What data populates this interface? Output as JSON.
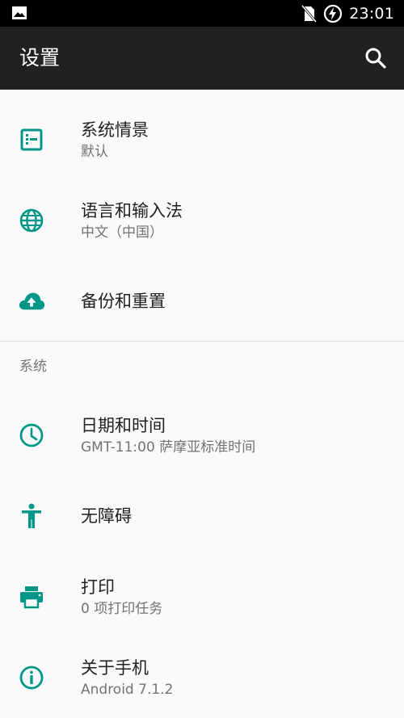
{
  "status_bar": {
    "time": "23:01",
    "icons": [
      "image-icon",
      "no-sim-icon",
      "battery-charging-icon"
    ]
  },
  "app_bar": {
    "title": "设置",
    "search_icon": "search-icon"
  },
  "accent_color": "#009688",
  "items_top": [
    {
      "icon": "theme-icon",
      "title": "系统情景",
      "subtitle": "默认"
    },
    {
      "icon": "globe-icon",
      "title": "语言和输入法",
      "subtitle": "中文（中国）"
    },
    {
      "icon": "cloud-upload-icon",
      "title": "备份和重置",
      "subtitle": ""
    }
  ],
  "section_system": {
    "header": "系统",
    "items": [
      {
        "icon": "clock-icon",
        "title": "日期和时间",
        "subtitle": "GMT-11:00 萨摩亚标准时间"
      },
      {
        "icon": "accessibility-icon",
        "title": "无障碍",
        "subtitle": ""
      },
      {
        "icon": "print-icon",
        "title": "打印",
        "subtitle": "0 项打印任务"
      },
      {
        "icon": "info-icon",
        "title": "关于手机",
        "subtitle": "Android 7.1.2"
      }
    ]
  }
}
